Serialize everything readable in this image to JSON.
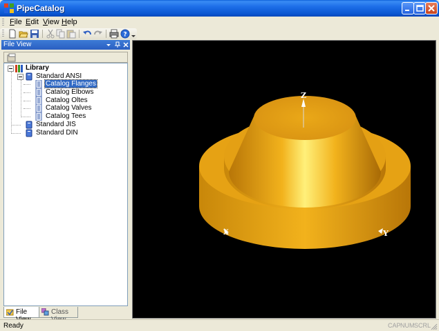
{
  "window": {
    "title": "PipeCatalog"
  },
  "menu": {
    "items": [
      {
        "label": "File",
        "accel": "F",
        "rest": "ile"
      },
      {
        "label": "Edit",
        "accel": "E",
        "rest": "dit"
      },
      {
        "label": "View",
        "accel": "V",
        "rest": "iew"
      },
      {
        "label": "Help",
        "accel": "H",
        "rest": "elp"
      }
    ]
  },
  "toolbar": {
    "buttons": [
      "new-icon",
      "open-icon",
      "save-icon",
      "cut-icon",
      "copy-icon",
      "paste-icon",
      "undo-icon",
      "redo-icon",
      "print-icon",
      "help-icon"
    ]
  },
  "panel": {
    "title": "File View"
  },
  "tree": {
    "root": "Library",
    "group1": "Standard ANSI",
    "children": [
      "Catalog Flanges",
      "Catalog Elbows",
      "Catalog Oltes",
      "Catalog Valves",
      "Catalog Tees"
    ],
    "group2": "Standard JIS",
    "group3": "Standard DIN",
    "selected": "Catalog Flanges"
  },
  "tabs": [
    {
      "label": "File View"
    },
    {
      "label": "Class View"
    }
  ],
  "viewport": {
    "axis_z": "Z",
    "axis_y": "Y",
    "axis_x": "X",
    "model_color": "#e8a010"
  },
  "status": {
    "text": "Ready",
    "indicators": [
      "CAP",
      "NUM",
      "SCRL"
    ]
  }
}
